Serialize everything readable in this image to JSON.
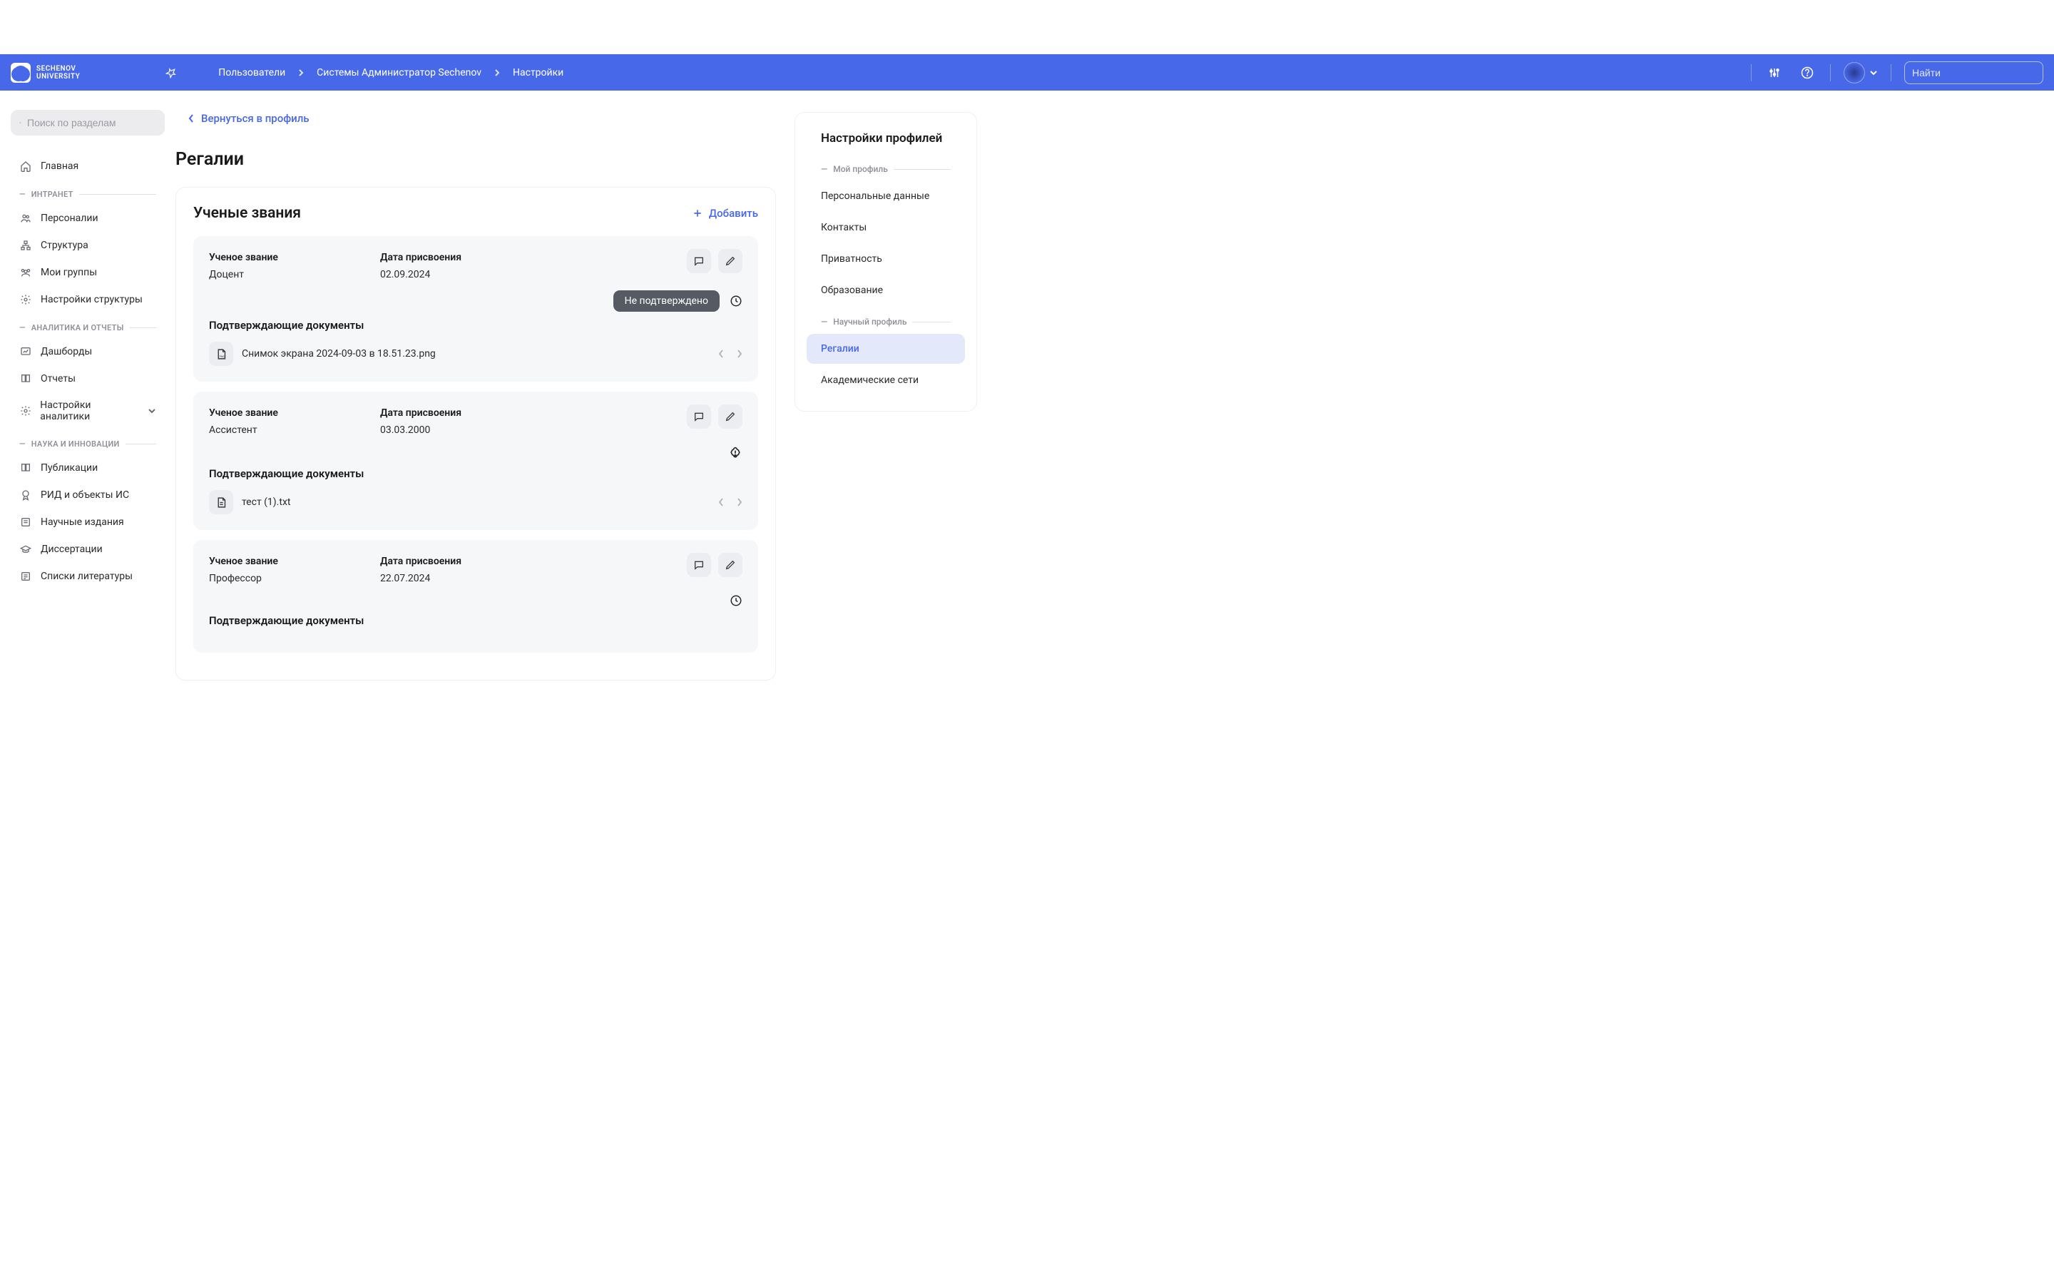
{
  "logo": {
    "line1": "SECHENOV",
    "line2": "UNIVERSITY"
  },
  "breadcrumbs": [
    "Пользователи",
    "Системы Администратор Sechenov",
    "Настройки"
  ],
  "search": {
    "placeholder": "Найти"
  },
  "sidebar": {
    "search_placeholder": "Поиск по разделам",
    "home": "Главная",
    "sections": [
      {
        "title": "ИНТРАНЕТ",
        "items": [
          "Персоналии",
          "Структура",
          "Мои группы",
          "Настройки структуры"
        ]
      },
      {
        "title": "АНАЛИТИКА И ОТЧЕТЫ",
        "items": [
          "Дашборды",
          "Отчеты",
          "Настройки аналитики"
        ]
      },
      {
        "title": "НАУКА И ИННОВАЦИИ",
        "items": [
          "Публикации",
          "РИД и объекты ИС",
          "Научные издания",
          "Диссертации",
          "Списки литературы"
        ]
      }
    ]
  },
  "back_link": "Вернуться в профиль",
  "page_title": "Регалии",
  "ranks": {
    "title": "Ученые звания",
    "add_label": "Добавить",
    "rank_label": "Ученое звание",
    "date_label": "Дата присвоения",
    "docs_label": "Подтверждающие документы",
    "unconfirmed_label": "Не подтверждено",
    "entries": [
      {
        "rank": "Доцент",
        "date": "02.09.2024",
        "status": "unconfirmed",
        "file": "Снимок экрана 2024-09-03 в 18.51.23.png",
        "file_icon": "png"
      },
      {
        "rank": "Ассистент",
        "date": "03.03.2000",
        "status": "warning",
        "file": "тест (1).txt",
        "file_icon": "txt"
      },
      {
        "rank": "Профессор",
        "date": "22.07.2024",
        "status": "clock",
        "file": "",
        "file_icon": ""
      }
    ]
  },
  "settings_panel": {
    "title": "Настройки профилей",
    "section_my": "Мой профиль",
    "items_my": [
      "Персональные данные",
      "Контакты",
      "Приватность",
      "Образование"
    ],
    "section_sci": "Научный профиль",
    "items_sci": [
      "Регалии",
      "Академические сети"
    ],
    "active": "Регалии"
  }
}
